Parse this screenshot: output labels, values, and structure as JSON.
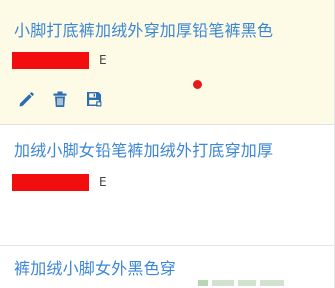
{
  "items": [
    {
      "title": "小脚打底裤加绒外穿加厚铅笔裤黑色"
    },
    {
      "title": "加绒小脚女铅笔裤加绒外打底穿加厚"
    },
    {
      "title": "裤加绒小脚女外黑色穿"
    }
  ],
  "redaction_tail": "E",
  "icons": {
    "edit": "pencil-icon",
    "delete": "trash-icon",
    "save": "save-icon"
  },
  "colors": {
    "title": "#3b86d6",
    "icon": "#2f6db2",
    "selected_bg": "#fdfbe6",
    "redaction": "#f20e0e",
    "dot": "#e51b1b"
  }
}
